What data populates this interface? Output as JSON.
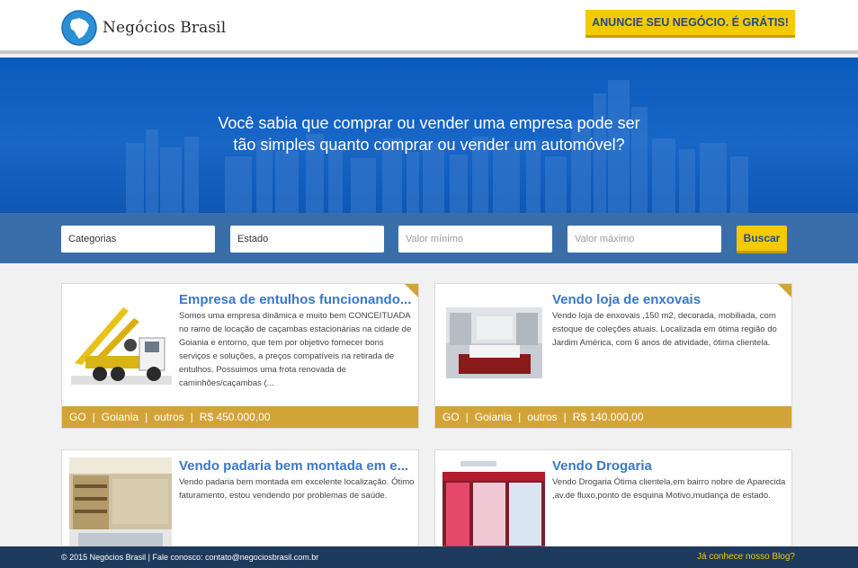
{
  "header": {
    "logo_text": "Negócios Brasil",
    "cta_label": "ANUNCIE SEU NEGÓCIO. É GRÁTIS!"
  },
  "hero": {
    "line1": "Você sabia que comprar ou vender uma empresa pode ser",
    "line2": "tão simples quanto comprar ou vender um automóvel?"
  },
  "search": {
    "categorias": "Categorias",
    "estado": "Estado",
    "valor_min_placeholder": "Valor mínimo",
    "valor_max_placeholder": "Valor máximo",
    "buscar_label": "Buscar"
  },
  "listings": [
    {
      "title": "Empresa de entulhos funcionando...",
      "description": "Somos uma empresa dinâmica e muito bem CONCEITUADA no ramo de locação de caçambas estacionárias na cidade de Goiania e entorno, que tem por objetivo fornecer bons serviços e soluções, a preços compatíveis na retirada de entulhos. Possuimos uma frota renovada de caminhões/caçambas (...",
      "state": "GO",
      "city": "Goiania",
      "category": "outros",
      "price": "R$ 450.000,00",
      "image": "truck-photo"
    },
    {
      "title": "Vendo loja de enxovais",
      "description": "Vendo loja de enxovais ,150 m2, decorada, mobiliada, com estoque de coleções atuais. Localizada em ótima região do Jardim América, com 6 anos de atividade, ótima clientela.",
      "state": "GO",
      "city": "Goiania",
      "category": "outros",
      "price": "R$ 140.000,00",
      "image": "store-photo"
    },
    {
      "title": "Vendo padaria bem montada em e...",
      "description": "Vendo padaria bem montada em excelente localização. Ótimo faturamento, estou vendendo por problemas de saúde.",
      "image": "bakery-photo"
    },
    {
      "title": "Vendo Drogaria",
      "description": "Vendo Drogaria Ótima clientela,em bairro nobre de Aparecida ,av.de fluxo,ponto de esquina Motivo,mudança de estado.",
      "image": "pharmacy-photo"
    }
  ],
  "footer": {
    "copyright": "© 2015 Negócios Brasil  | Fale conosco: contato@negociosbrasil.com.br",
    "blog_link": "Já conhece nosso Blog?"
  },
  "colors": {
    "accent_yellow": "#f6c900",
    "meta_gold": "#d2a437",
    "link_blue": "#3b78c4",
    "hero_blue": "#1866c6",
    "footer_navy": "#1e3a5c"
  }
}
